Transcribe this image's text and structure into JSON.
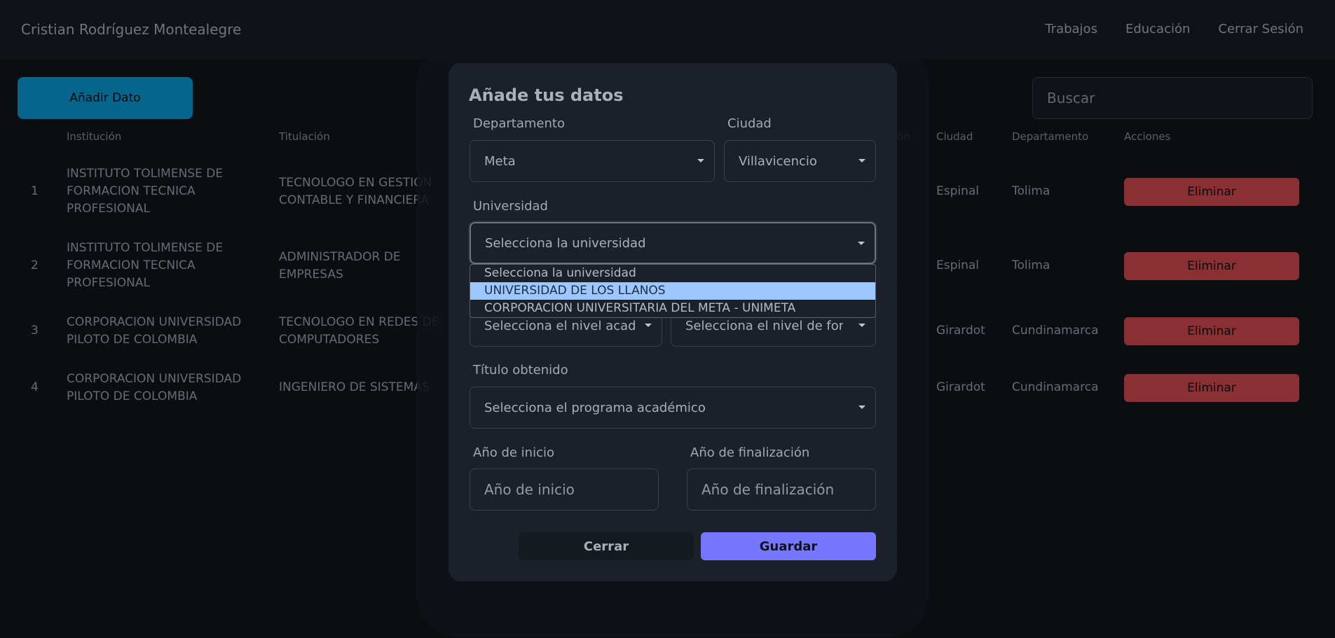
{
  "navbar": {
    "brand": "Cristian Rodríguez Montealegre",
    "links": [
      "Trabajos",
      "Educación",
      "Cerrar Sesión"
    ]
  },
  "toolbar": {
    "add_label": "Añadir Dato",
    "search_placeholder": "Buscar"
  },
  "table": {
    "headers": [
      "Institución",
      "Titulación",
      "ón",
      "Ciudad",
      "Departamento",
      "Acciones"
    ],
    "rows": [
      {
        "n": "1",
        "institution": "INSTITUTO TOLIMENSE DE FORMACION TECNICA PROFESIONAL",
        "title": "TECNOLOGO EN GESTIÓN CONTABLE Y FINANCIERA",
        "city": "Espinal",
        "dept": "Tolima",
        "action": "Eliminar"
      },
      {
        "n": "2",
        "institution": "INSTITUTO TOLIMENSE DE FORMACION TECNICA PROFESIONAL",
        "title": "ADMINISTRADOR DE EMPRESAS",
        "city": "Espinal",
        "dept": "Tolima",
        "action": "Eliminar"
      },
      {
        "n": "3",
        "institution": "CORPORACION UNIVERSIDAD PILOTO DE COLOMBIA",
        "title": "TECNOLOGO EN REDES DE COMPUTADORES",
        "city": "Girardot",
        "dept": "Cundinamarca",
        "action": "Eliminar"
      },
      {
        "n": "4",
        "institution": "CORPORACION UNIVERSIDAD PILOTO DE COLOMBIA",
        "title": "INGENIERO DE SISTEMAS",
        "city": "Girardot",
        "dept": "Cundinamarca",
        "action": "Eliminar"
      }
    ]
  },
  "modal": {
    "title": "Añade tus datos",
    "departamento_label": "Departamento",
    "departamento_value": "Meta",
    "ciudad_label": "Ciudad",
    "ciudad_value": "Villavicencio",
    "universidad_label": "Universidad",
    "universidad_value": "Selecciona la universidad",
    "universidad_options": [
      "Selecciona la universidad",
      "UNIVERSIDAD DE LOS LLANOS",
      "CORPORACION UNIVERSITARIA DEL META - UNIMETA"
    ],
    "nivel_academico_value": "Selecciona el nivel académico",
    "nivel_formacion_value": "Selecciona el nivel de formación",
    "titulo_label": "Título obtenido",
    "titulo_value": "Selecciona el programa académico",
    "inicio_label": "Año de inicio",
    "inicio_placeholder": "Año de inicio",
    "fin_label": "Año de finalización",
    "fin_placeholder": "Año de finalización",
    "close_label": "Cerrar",
    "save_label": "Guardar"
  },
  "colors": {
    "add_button": "#06658a",
    "delete_button": "#8a3033",
    "save_button": "#7578fd",
    "dropdown_highlight": "#9cc8ff"
  }
}
